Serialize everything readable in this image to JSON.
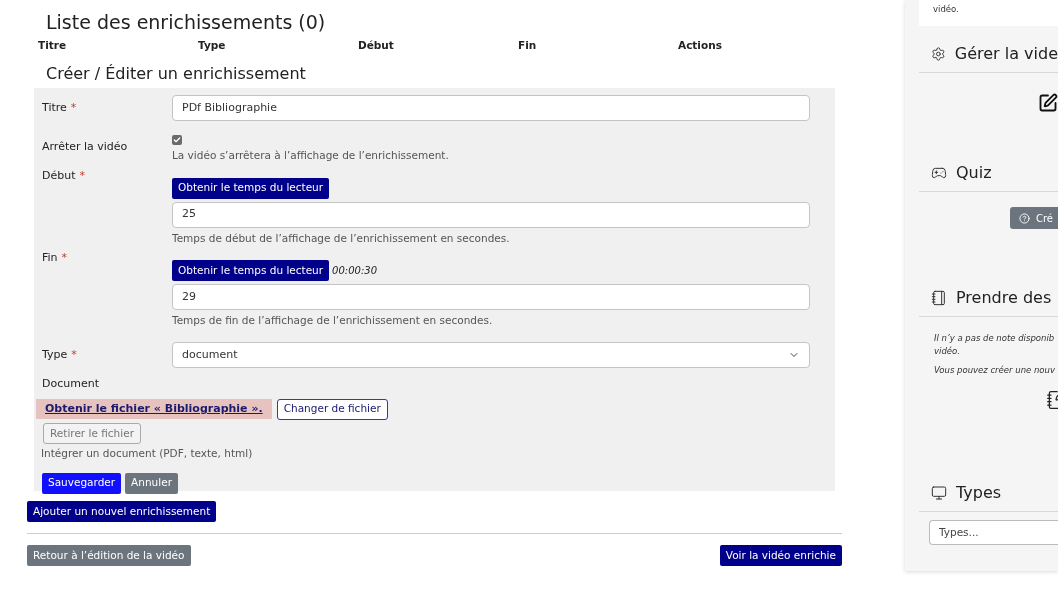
{
  "list": {
    "title": "Liste des enrichissements (0)",
    "columns": [
      "Titre",
      "Type",
      "Début",
      "Fin",
      "Actions"
    ]
  },
  "form": {
    "title": "Créer / Éditer un enrichissement",
    "fields": [
      {
        "kind": "text",
        "label": "Titre",
        "required_mark": "*",
        "value": "PDf Bibliographie"
      },
      {
        "kind": "checkbox",
        "label": "Arrêter la vidéo",
        "checked": true,
        "help": "La vidéo s’arrêtera à l’affichage de l’enrichissement."
      },
      {
        "kind": "time",
        "label": "Début",
        "required_mark": "*",
        "button": "Obtenir le temps du lecteur",
        "value": "25",
        "help": "Temps de début de l’affichage de l’enrichissement en secondes."
      },
      {
        "kind": "time",
        "label": "Fin",
        "required_mark": "*",
        "button": "Obtenir le temps du lecteur",
        "time": "00:00:30",
        "value": "29",
        "help": "Temps de fin de l’affichage de l’enrichissement en secondes."
      },
      {
        "kind": "select",
        "label": "Type",
        "required_mark": "*",
        "value": "document"
      },
      {
        "kind": "file",
        "label": "Document",
        "link": "Obtenir le fichier « Bibliographie ».",
        "change_button": "Changer de fichier",
        "remove_button": "Retirer le fichier",
        "help": "Intégrer un document (PDF, texte, html)"
      }
    ],
    "buttons": [
      {
        "kind": "primary",
        "label": "Sauvegarder"
      },
      {
        "kind": "secondary",
        "label": "Annuler"
      }
    ]
  },
  "add_button": "Ajouter un nouvel enrichissement",
  "footer_buttons": [
    {
      "kind": "secondary",
      "label": "Retour à l’édition de la vidéo"
    },
    {
      "kind": "dark",
      "label": "Voir la vidéo enrichie"
    }
  ],
  "sidebar": {
    "card_text": "vidéo.",
    "sections": [
      {
        "kind": "manage",
        "title": "Gérer la vide"
      },
      {
        "kind": "quiz",
        "title": "Quiz",
        "button": "Cré"
      },
      {
        "kind": "notes",
        "title": "Prendre des",
        "notes": [
          "Il n’y a pas de note disponib",
          "vidéo.",
          "Vous pouvez créer une nouv"
        ]
      },
      {
        "kind": "types",
        "title": "Types",
        "placeholder": "Types..."
      }
    ]
  }
}
